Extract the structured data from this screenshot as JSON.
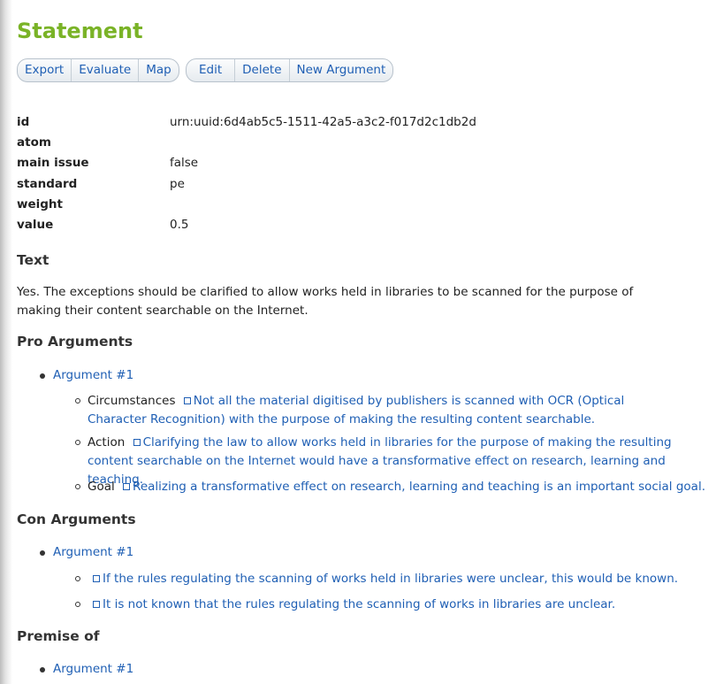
{
  "page": {
    "title": "Statement"
  },
  "toolbar": {
    "group1": [
      "Export",
      "Evaluate",
      "Map"
    ],
    "group2": [
      "Edit",
      "Delete",
      "New Argument"
    ]
  },
  "properties": [
    {
      "key": "id",
      "value": "urn:uuid:6d4ab5c5-1511-42a5-a3c2-f017d2c1db2d"
    },
    {
      "key": "atom",
      "value": ""
    },
    {
      "key": "main issue",
      "value": "false"
    },
    {
      "key": "standard",
      "value": "pe"
    },
    {
      "key": "weight",
      "value": ""
    },
    {
      "key": "value",
      "value": "0.5"
    }
  ],
  "text_section": {
    "heading": "Text",
    "body": "Yes. The exceptions should be clarified to allow works held in libraries to be scanned for the purpose of making their content searchable on the Internet."
  },
  "pro_arguments": {
    "heading": "Pro Arguments",
    "argument_label": "Argument #1",
    "premises": [
      {
        "role": "Circumstances",
        "text": "Not all the material digitised by publishers is scanned with OCR (Optical Character Recognition) with the purpose of making the resulting content searchable."
      },
      {
        "role": "Action",
        "text": "Clarifying the law to allow works held in libraries for the purpose of making the resulting content searchable on the Internet would have a transformative effect on research, learning and teaching."
      },
      {
        "role": "Goal",
        "text": "Realizing a transformative effect on research, learning and teaching is an important social goal."
      }
    ]
  },
  "con_arguments": {
    "heading": "Con Arguments",
    "argument_label": "Argument #1",
    "premises": [
      {
        "role": "",
        "text": "If the rules regulating the scanning of works held in libraries were unclear, this would be known."
      },
      {
        "role": "",
        "text": "It is not known that the rules regulating the scanning of works in libraries are unclear."
      }
    ]
  },
  "premise_of": {
    "heading": "Premise of",
    "argument_label": "Argument #1"
  }
}
